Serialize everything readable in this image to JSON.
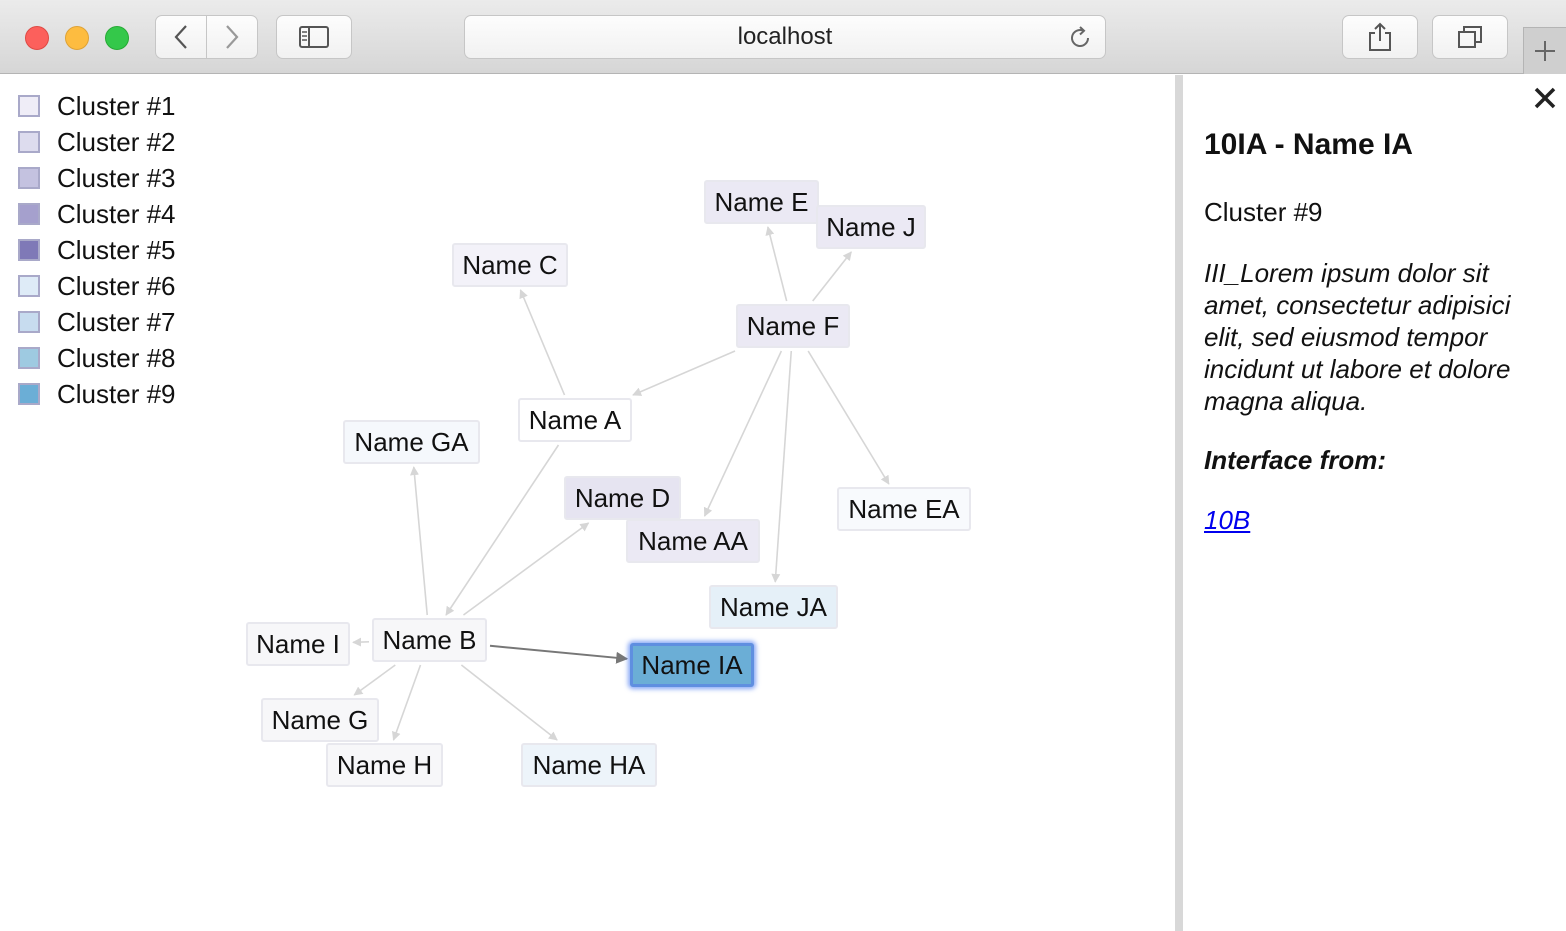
{
  "browser": {
    "url": "localhost"
  },
  "legend": [
    {
      "label": "Cluster #1",
      "color": "#efedf7"
    },
    {
      "label": "Cluster #2",
      "color": "#dddcee"
    },
    {
      "label": "Cluster #3",
      "color": "#c4c2e0"
    },
    {
      "label": "Cluster #4",
      "color": "#a5a0cd"
    },
    {
      "label": "Cluster #5",
      "color": "#7f79b7"
    },
    {
      "label": "Cluster #6",
      "color": "#deebf7"
    },
    {
      "label": "Cluster #7",
      "color": "#c7dcef"
    },
    {
      "label": "Cluster #8",
      "color": "#9ecae1"
    },
    {
      "label": "Cluster #9",
      "color": "#6baed6"
    }
  ],
  "graph": {
    "nodes": [
      {
        "id": "E",
        "label": "Name E",
        "color": "#ebe9f4"
      },
      {
        "id": "J",
        "label": "Name J",
        "color": "#ebe9f4"
      },
      {
        "id": "C",
        "label": "Name C",
        "color": "#f3f2f9"
      },
      {
        "id": "F",
        "label": "Name F",
        "color": "#ebe9f4"
      },
      {
        "id": "A",
        "label": "Name A",
        "color": "#ffffff"
      },
      {
        "id": "GA",
        "label": "Name GA",
        "color": "#f5f8fc"
      },
      {
        "id": "D",
        "label": "Name D",
        "color": "#e6e4f1"
      },
      {
        "id": "AA",
        "label": "Name AA",
        "color": "#ebe9f4"
      },
      {
        "id": "EA",
        "label": "Name EA",
        "color": "#f8fafd"
      },
      {
        "id": "JA",
        "label": "Name JA",
        "color": "#e5f0f8"
      },
      {
        "id": "I",
        "label": "Name I",
        "color": "#f7f7f9"
      },
      {
        "id": "B",
        "label": "Name B",
        "color": "#f7f7f9"
      },
      {
        "id": "IA",
        "label": "Name IA",
        "color": "#6baed6",
        "selected": true
      },
      {
        "id": "G",
        "label": "Name G",
        "color": "#f7f7f9"
      },
      {
        "id": "H",
        "label": "Name H",
        "color": "#f7f7f9"
      },
      {
        "id": "HA",
        "label": "Name HA",
        "color": "#edf4fa"
      }
    ],
    "edges": [
      {
        "from": "F",
        "to": "E"
      },
      {
        "from": "F",
        "to": "J"
      },
      {
        "from": "F",
        "to": "A"
      },
      {
        "from": "F",
        "to": "AA"
      },
      {
        "from": "F",
        "to": "JA"
      },
      {
        "from": "F",
        "to": "EA"
      },
      {
        "from": "A",
        "to": "C"
      },
      {
        "from": "A",
        "to": "B"
      },
      {
        "from": "B",
        "to": "D"
      },
      {
        "from": "B",
        "to": "GA"
      },
      {
        "from": "B",
        "to": "I"
      },
      {
        "from": "B",
        "to": "G"
      },
      {
        "from": "B",
        "to": "H"
      },
      {
        "from": "B",
        "to": "HA"
      },
      {
        "from": "B",
        "to": "IA",
        "highlighted": true
      }
    ]
  },
  "panel": {
    "title": "10IA - Name IA",
    "cluster": "Cluster #9",
    "description": "III_Lorem ipsum dolor sit amet, consectetur adipisici elit, sed eiusmod tempor incidunt ut labore et dolore magna aliqua.",
    "interface_label": "Interface from:",
    "interface_link": "10B"
  }
}
